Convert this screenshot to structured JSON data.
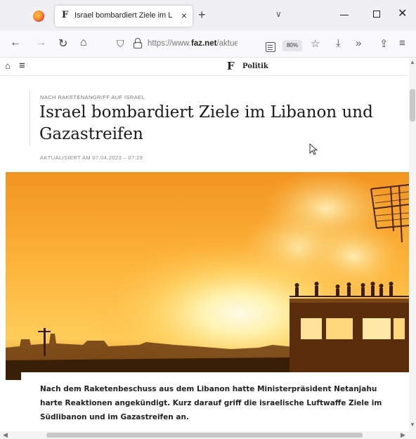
{
  "browser": {
    "tab": {
      "favicon": "F",
      "title": "Israel bombardiert Ziele im Libanon"
    },
    "new_tab_symbol": "+",
    "tab_list_symbol": "∨",
    "window_controls": {
      "minimize": "—",
      "close": "✕"
    },
    "nav": {
      "back": "←",
      "forward": "→",
      "reload": "↻",
      "home": "⌂"
    },
    "url": {
      "prefix": "https://www.",
      "domain": "faz.net",
      "path": "/aktuell/po"
    },
    "zoom": "80%",
    "toolbar_icons": {
      "star": "☆",
      "download": "⤓",
      "overflow": "»",
      "extensions": "⇪",
      "menu": "≡"
    }
  },
  "site": {
    "home_symbol": "⌂",
    "menu_symbol": "≡",
    "logo": "F",
    "section": "Politik"
  },
  "article": {
    "kicker": "NACH RAKETENANGRIFF AUF ISRAEL",
    "headline": "Israel bombardiert Ziele im Libanon und Gazastreifen",
    "meta": "AKTUALISIERT AM 07.04.2023 – 07:29",
    "lead": "Nach dem Raketenbeschuss aus dem Libanon hatte Ministerpräsident Netanjahu harte Reaktionen angekündigt. Kurz darauf griff die israelische Luftwaffe Ziele im Südlibanon und im Gazastreifen an."
  },
  "scrollbars": {
    "up": "▲",
    "down": "▼",
    "left": "◀",
    "right": "▶"
  },
  "colors": {
    "browser_chrome": "#f0f0f4",
    "toolbar": "#f9f9fb",
    "hero_sky": "#ffb43c",
    "hero_sun": "#fff6c8"
  }
}
